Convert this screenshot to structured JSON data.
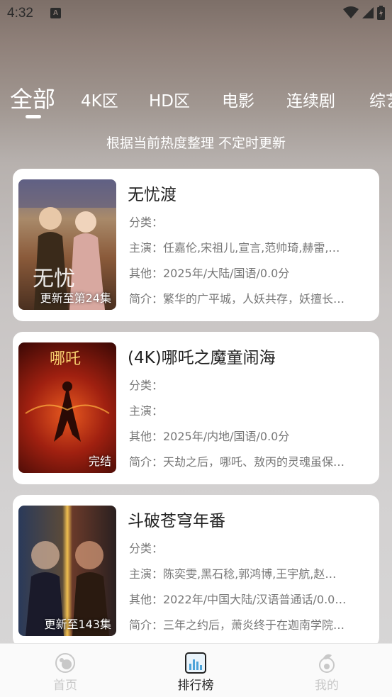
{
  "status_bar": {
    "time": "4:32",
    "notification": "A"
  },
  "tabs": [
    {
      "label": "全部",
      "active": true
    },
    {
      "label": "4K区"
    },
    {
      "label": "HD区"
    },
    {
      "label": "电影"
    },
    {
      "label": "连续剧"
    },
    {
      "label": "综艺"
    }
  ],
  "subtitle": "根据当前热度整理 不定时更新",
  "items": [
    {
      "title": "无忧渡",
      "badge": "更新至第24集",
      "category": "分类：",
      "cast": "主演：任嘉伦,宋祖儿,宣言,范帅琦,赫雷,…",
      "other": "其他：2025年/大陆/国语/0.0分",
      "intro": "简介：繁华的广平城，人妖共存，妖擅长…"
    },
    {
      "title": "(4K)哪吒之魔童闹海",
      "badge": "完结",
      "category": "分类：",
      "cast": "主演：",
      "other": "其他：2025年/内地/国语/0.0分",
      "intro": "简介：天劫之后，哪吒、敖丙的灵魂虽保…"
    },
    {
      "title": "斗破苍穹年番",
      "badge": "更新至143集",
      "category": "分类：",
      "cast": "主演：陈奕雯,黑石稔,郭鸿博,王宇航,赵…",
      "other": "其他：2022年/中国大陆/汉语普通话/0.0…",
      "intro": "简介：三年之约后，萧炎终于在迦南学院…"
    }
  ],
  "nav": [
    {
      "label": "首页",
      "icon": "home-icon"
    },
    {
      "label": "排行榜",
      "icon": "ranking-icon",
      "active": true
    },
    {
      "label": "我的",
      "icon": "profile-icon"
    }
  ],
  "colors": {
    "card": "#ffffff",
    "accent_active": "#222222",
    "nav_inactive": "#c8c8c8",
    "ranking_icon": "#4ba3d9"
  }
}
